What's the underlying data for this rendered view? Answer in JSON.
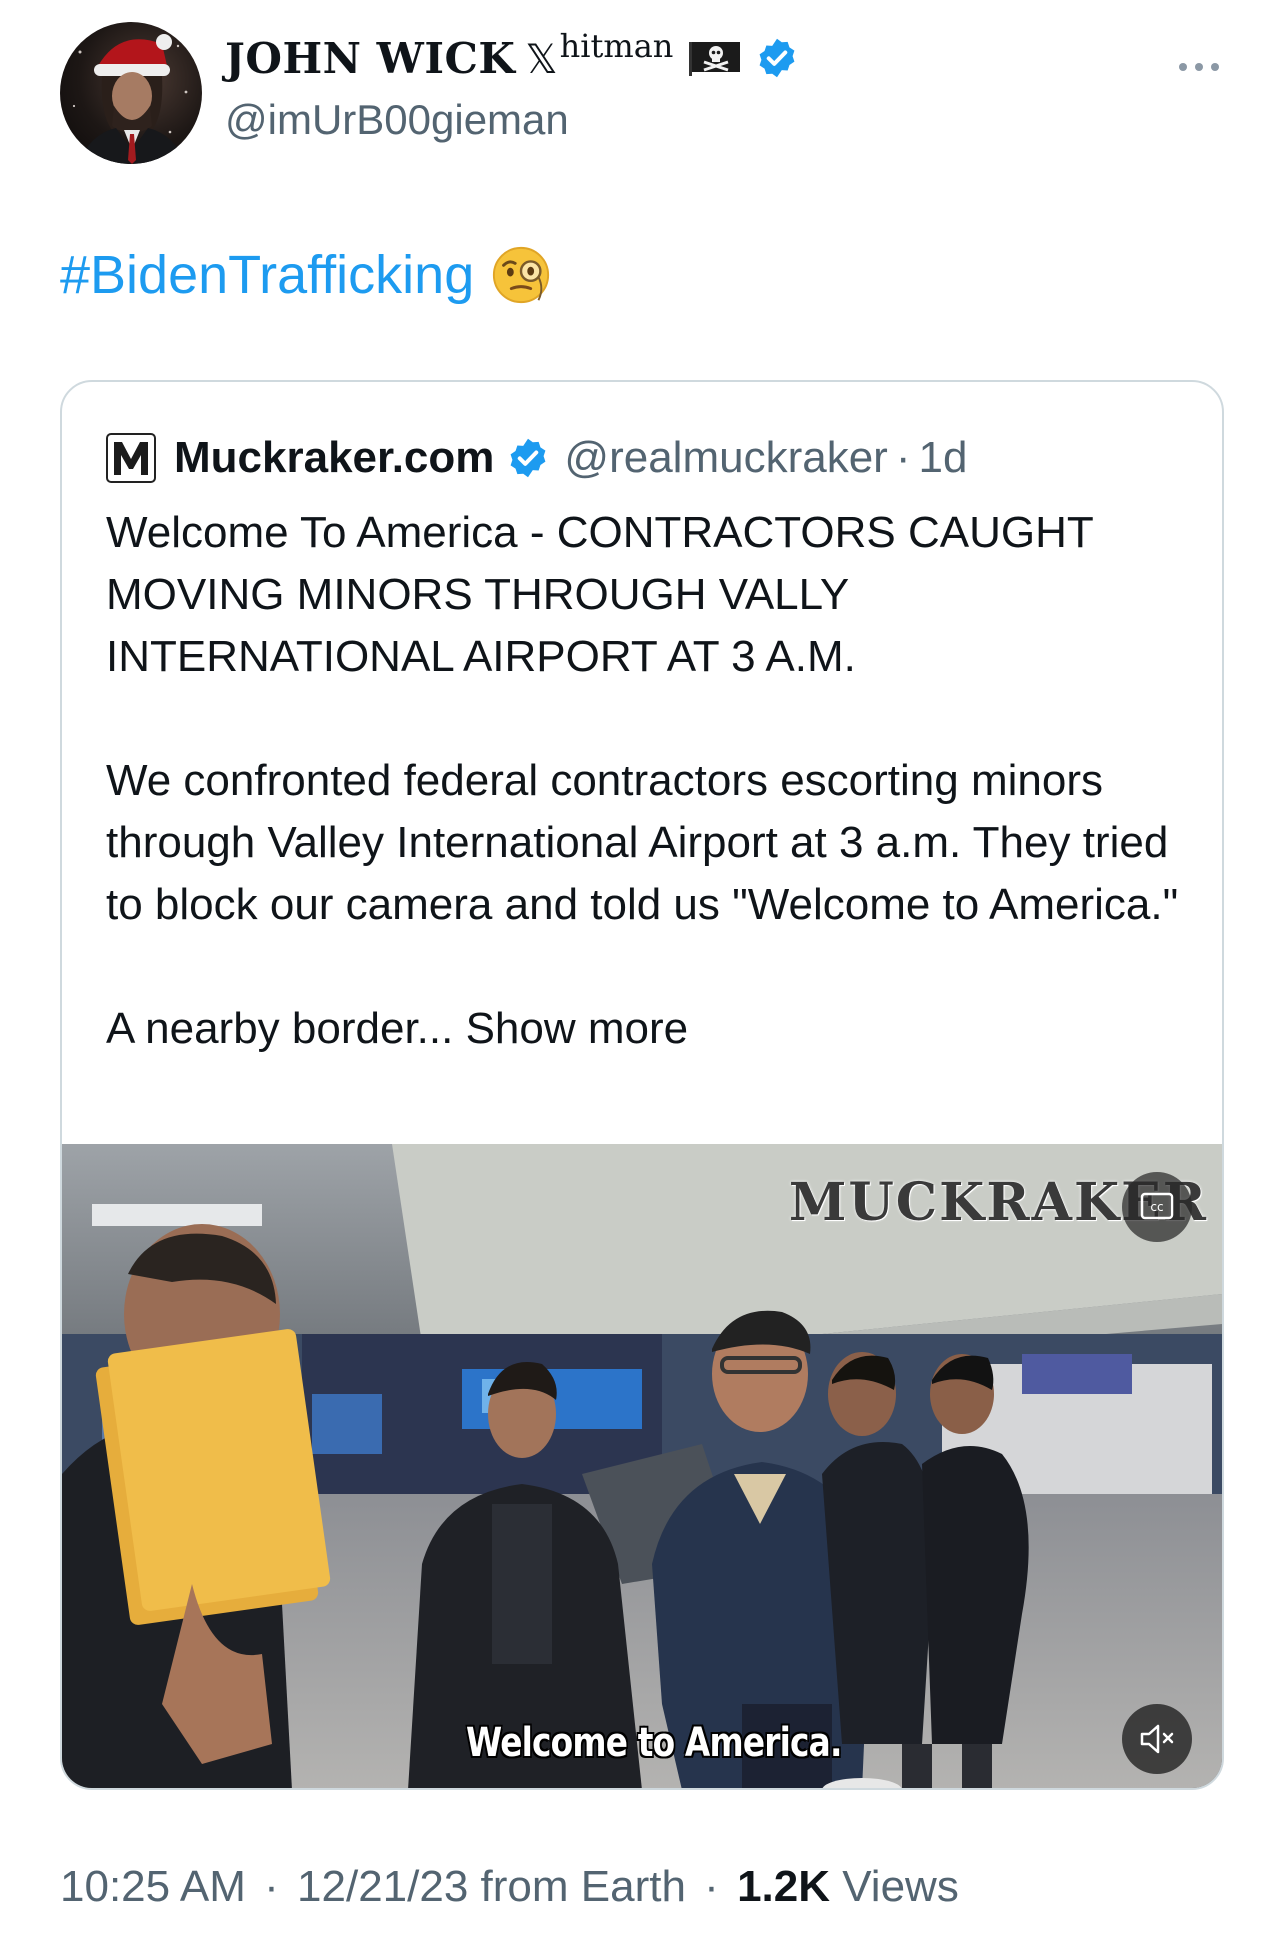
{
  "author": {
    "display_name": "JOHN WICK",
    "name_x_mark": "𝕏",
    "name_superscript": "hitman",
    "handle": "@imUrB00gieman",
    "verified": true,
    "flag_icon": "pirate-flag-icon"
  },
  "tweet": {
    "hashtag": "#BidenTrafficking",
    "emoji": "face-with-monocle"
  },
  "quote": {
    "name": "Muckraker.com",
    "handle": "@realmuckraker",
    "separator": "·",
    "time": "1d",
    "verified": true,
    "paragraph1": "Welcome To America - CONTRACTORS CAUGHT MOVING MINORS THROUGH VALLY INTERNATIONAL AIRPORT AT 3 A.M.",
    "paragraph2": "We confronted federal contractors escorting minors through Valley International Airport at 3 a.m. They tried to block our camera and told us \"Welcome to America.\"",
    "paragraph3": "A nearby border...",
    "show_more": "Show more",
    "video": {
      "watermark": "MUCKRAKER",
      "caption": "Welcome to America.",
      "cc_icon": "closed-captions-icon",
      "mute_icon": "speaker-muted-icon"
    }
  },
  "footer": {
    "time": "10:25 AM",
    "sep1": "·",
    "date": "12/21/23",
    "location": "from Earth",
    "sep2": "·",
    "views_count": "1.2K",
    "views_label": "Views"
  },
  "colors": {
    "link": "#1d9bf0",
    "secondary_text": "#536471",
    "border": "#cfd9de",
    "primary_text": "#0f1419"
  }
}
